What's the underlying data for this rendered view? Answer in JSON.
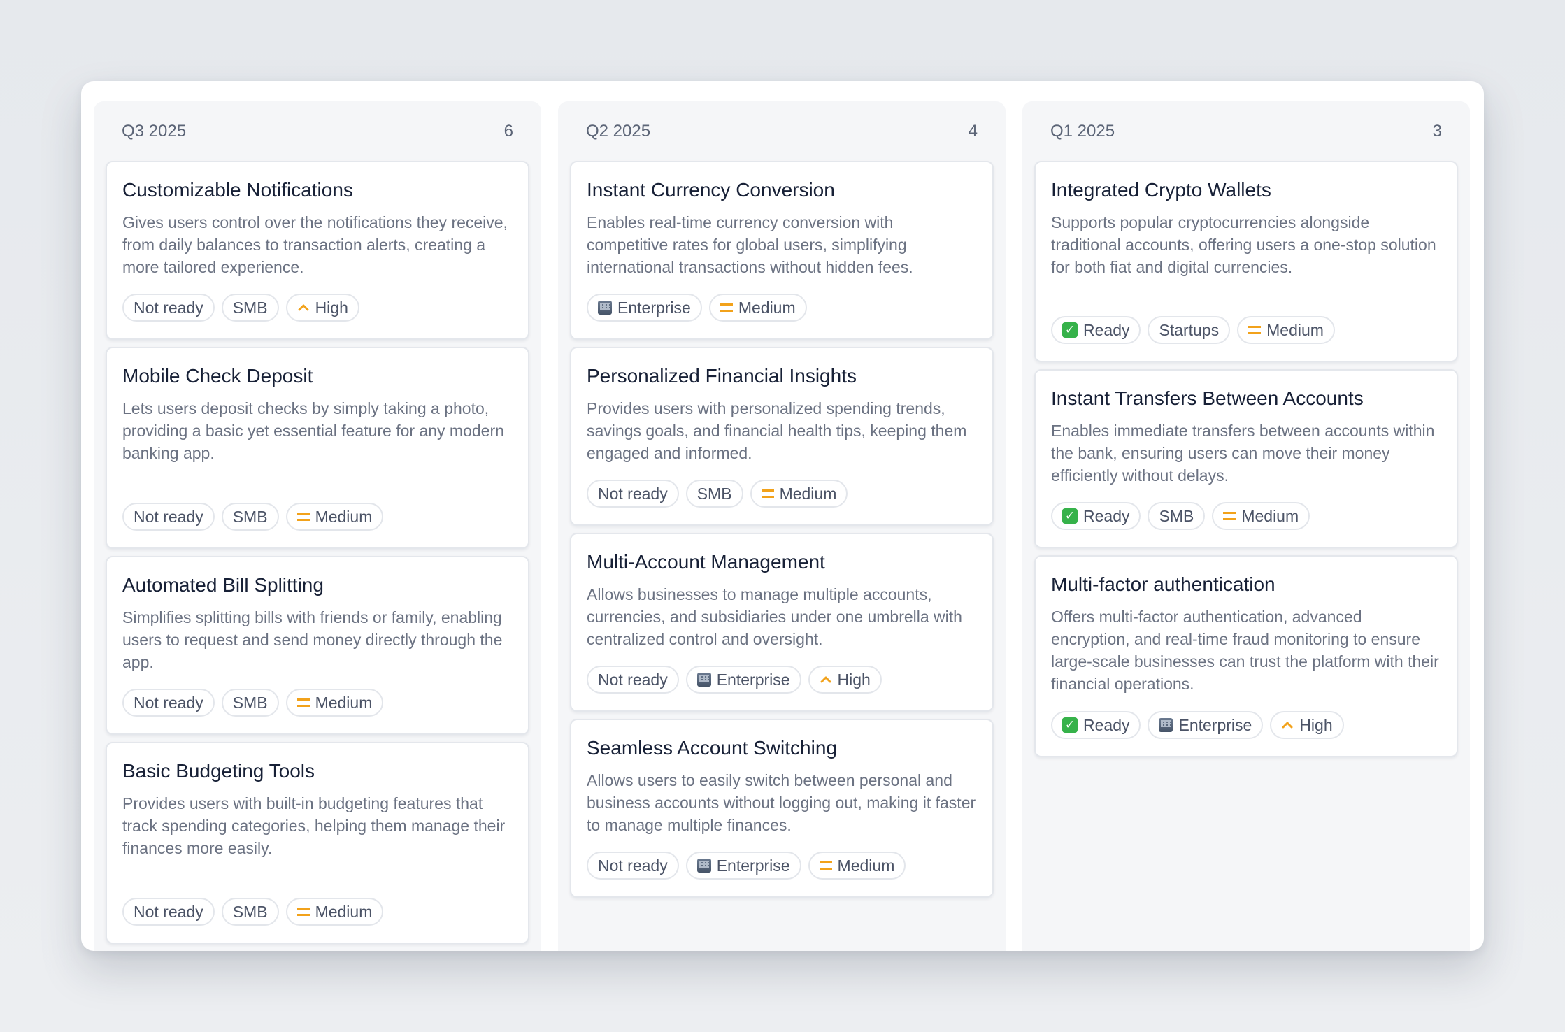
{
  "columns": [
    {
      "title": "Q3 2025",
      "count": "6",
      "cards": [
        {
          "title": "Customizable Notifications",
          "desc": "Gives users control over the notifications they receive, from daily balances to transaction alerts, creating a more tailored experience.",
          "status": "Not ready",
          "segment": "SMB",
          "priority": "High"
        },
        {
          "title": "Mobile Check Deposit",
          "desc": "Lets users deposit checks by simply taking a photo, providing a basic yet essential feature for any modern banking app.",
          "status": "Not ready",
          "segment": "SMB",
          "priority": "Medium"
        },
        {
          "title": "Automated Bill Splitting",
          "desc": "Simplifies splitting bills with friends or family, enabling users to request and send money directly through the app.",
          "status": "Not ready",
          "segment": "SMB",
          "priority": "Medium"
        },
        {
          "title": "Basic Budgeting Tools",
          "desc": "Provides users with built-in budgeting features that track spending categories, helping them manage their finances more easily.",
          "status": "Not ready",
          "segment": "SMB",
          "priority": "Medium"
        }
      ]
    },
    {
      "title": "Q2 2025",
      "count": "4",
      "cards": [
        {
          "title": "Instant Currency Conversion",
          "desc": "Enables real-time currency conversion with competitive rates for global users, simplifying international transactions without hidden fees.",
          "segment": "Enterprise",
          "priority": "Medium"
        },
        {
          "title": "Personalized Financial Insights",
          "desc": "Provides users with personalized spending trends, savings goals, and financial health tips, keeping them engaged and informed.",
          "status": "Not ready",
          "segment": "SMB",
          "priority": "Medium"
        },
        {
          "title": "Multi-Account Management",
          "desc": "Allows businesses to manage multiple accounts, currencies, and subsidiaries under one umbrella with centralized control and oversight.",
          "status": "Not ready",
          "segment": "Enterprise",
          "priority": "High"
        },
        {
          "title": "Seamless Account Switching",
          "desc": "Allows users to easily switch between personal and business accounts without logging out, making it faster to manage multiple finances.",
          "status": "Not ready",
          "segment": "Enterprise",
          "priority": "Medium"
        }
      ]
    },
    {
      "title": "Q1 2025",
      "count": "3",
      "cards": [
        {
          "title": "Integrated Crypto Wallets",
          "desc": "Supports popular cryptocurrencies alongside traditional accounts, offering users a one-stop solution for both fiat and digital currencies.",
          "status": "Ready",
          "segment": "Startups",
          "priority": "Medium"
        },
        {
          "title": "Instant Transfers Between Accounts",
          "desc": "Enables immediate transfers between accounts within the bank, ensuring users can move their money efficiently without delays.",
          "status": "Ready",
          "segment": "SMB",
          "priority": "Medium"
        },
        {
          "title": "Multi-factor authentication",
          "desc": "Offers multi-factor authentication, advanced encryption, and real-time fraud monitoring to ensure large-scale businesses can trust the platform with their financial operations.",
          "status": "Ready",
          "segment": "Enterprise",
          "priority": "High"
        }
      ]
    }
  ],
  "icons": {
    "ready": "check-mark-icon",
    "enterprise": "office-building-icon",
    "medium": "equals-icon",
    "high": "chevron-up-icon"
  },
  "colors": {
    "priority": "#f2a21b",
    "ready": "#36b24a",
    "title": "#172036",
    "muted": "#6b7282"
  }
}
